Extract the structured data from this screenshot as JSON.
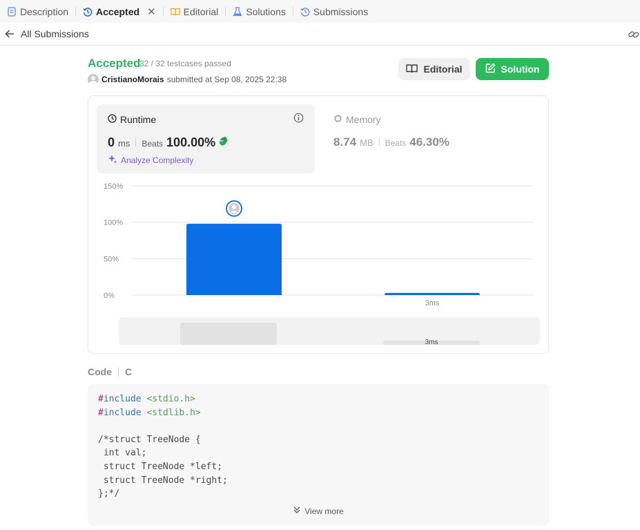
{
  "tabs": [
    {
      "label": "Description",
      "icon": "description-icon"
    },
    {
      "label": "Accepted",
      "icon": "history-icon",
      "active": true
    },
    {
      "label": "Editorial",
      "icon": "book-icon"
    },
    {
      "label": "Solutions",
      "icon": "flask-icon"
    },
    {
      "label": "Submissions",
      "icon": "history-icon"
    }
  ],
  "subheader": {
    "back_label": "All Submissions"
  },
  "submission": {
    "status": "Accepted",
    "passed": "32 / 32 testcases passed",
    "author": "CristianoMorais",
    "submitted_text": "submitted at Sep 08, 2025 22:38"
  },
  "buttons": {
    "editorial": "Editorial",
    "solution": "Solution"
  },
  "runtime": {
    "title": "Runtime",
    "value": "0",
    "unit": "ms",
    "beats_label": "Beats",
    "beats_value": "100.00%",
    "analyze": "Analyze Complexity"
  },
  "memory": {
    "title": "Memory",
    "value": "8.74",
    "unit": "MB",
    "beats_label": "Beats",
    "beats_value": "46.30%"
  },
  "colors": {
    "accepted": "#2db55d",
    "solution_btn": "#2cbb5d",
    "bar": "#0a6ee6",
    "analyze": "#7b5be0"
  },
  "chart_data": {
    "type": "bar",
    "y_ticks": [
      "150%",
      "100%",
      "50%",
      "0%"
    ],
    "ylim": [
      0,
      150
    ],
    "bars": [
      {
        "label": "",
        "value": 98,
        "selected": true
      },
      {
        "label": "3ms",
        "value": 3
      }
    ],
    "overview_label": "3ms"
  },
  "code": {
    "label": "Code",
    "language": "C",
    "lines": [
      [
        "#include",
        " <stdio.h>"
      ],
      [
        "#include",
        " <stdlib.h>"
      ],
      [
        "",
        ""
      ],
      [
        "/*struct TreeNode {",
        ""
      ],
      [
        " int val;",
        ""
      ],
      [
        " struct TreeNode *left;",
        ""
      ],
      [
        " struct TreeNode *right;",
        ""
      ],
      [
        "};*/",
        ""
      ]
    ],
    "view_more": "View more"
  }
}
